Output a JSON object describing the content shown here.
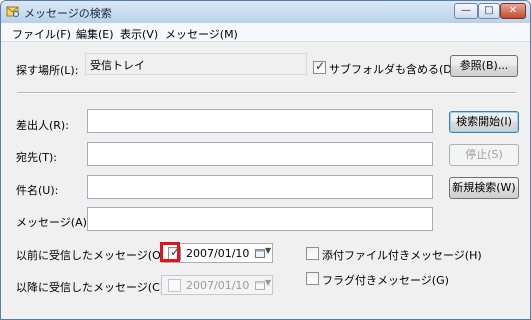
{
  "window": {
    "title": "メッセージの検索"
  },
  "menu": [
    {
      "label": "ファイル(F)"
    },
    {
      "label": "編集(E)"
    },
    {
      "label": "表示(V)"
    },
    {
      "label": "メッセージ(M)"
    }
  ],
  "search_location": {
    "label": "探す場所(L):",
    "value": "受信トレイ",
    "include_subfolders_label": "サブフォルダも含める(D)",
    "include_subfolders_checked": true,
    "browse_button": "参照(B)..."
  },
  "fields": {
    "from_label": "差出人(R):",
    "to_label": "宛先(T):",
    "subject_label": "件名(U):",
    "message_label": "メッセージ(A):"
  },
  "buttons": {
    "start_search": "検索開始(I)",
    "stop": "停止(S)",
    "new_search": "新規検索(W)"
  },
  "received_before": {
    "label": "以前に受信したメッセージ(O):",
    "checked": true,
    "date": "2007/01/10"
  },
  "received_after": {
    "label": "以降に受信したメッセージ(C):",
    "checked": false,
    "date": "2007/01/10"
  },
  "options": {
    "has_attachment_label": "添付ファイル付きメッセージ(H)",
    "flagged_label": "フラグ付きメッセージ(G)"
  },
  "colors": {
    "highlight": "#e0141b",
    "default_button_border": "#3c7fb1"
  }
}
